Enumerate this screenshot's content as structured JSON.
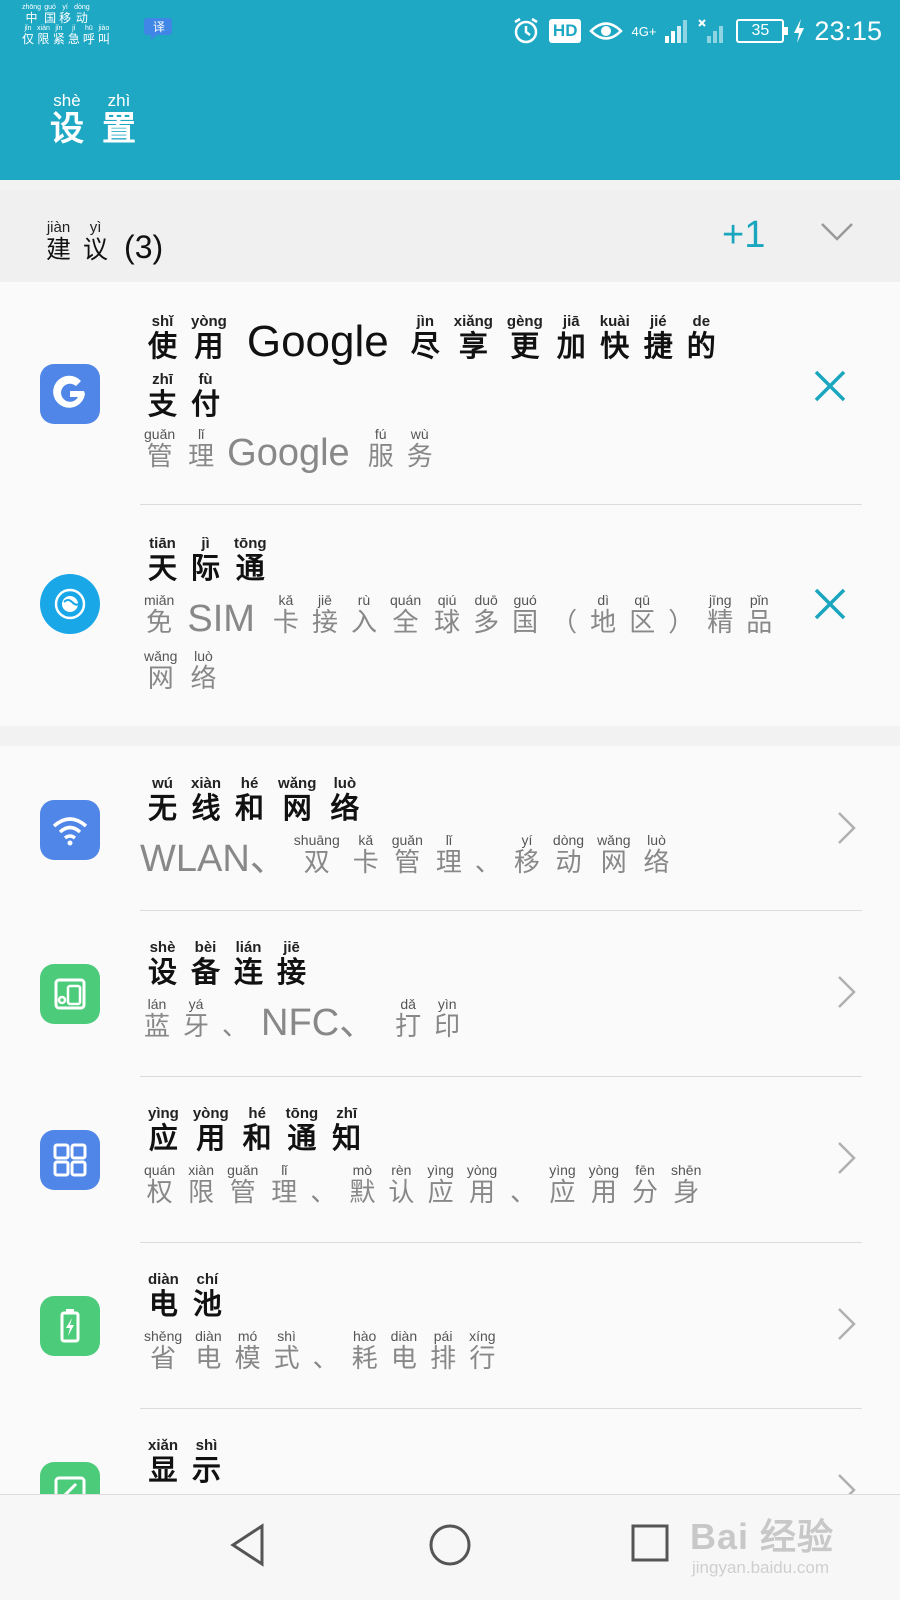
{
  "status_bar": {
    "carrier_line1": [
      {
        "char": "中",
        "py": "zhōng"
      },
      {
        "char": "国",
        "py": "guó"
      },
      {
        "char": "移",
        "py": "yí"
      },
      {
        "char": "动",
        "py": "dòng"
      }
    ],
    "carrier_line2": [
      {
        "char": "仅",
        "py": "jǐn"
      },
      {
        "char": "限",
        "py": "xiàn"
      },
      {
        "char": "紧",
        "py": "jǐn"
      },
      {
        "char": "急",
        "py": "jí"
      },
      {
        "char": "呼",
        "py": "hū"
      },
      {
        "char": "叫",
        "py": "jiào"
      }
    ],
    "translate_glyph": "译",
    "hd_label": "HD",
    "network_label": "4G+",
    "battery_level": "35",
    "time": "23:15"
  },
  "header": {
    "title": [
      {
        "char": "设",
        "py": "shè"
      },
      {
        "char": "置",
        "py": "zhì"
      }
    ]
  },
  "suggestions": {
    "title": [
      {
        "char": "建",
        "py": "jiàn"
      },
      {
        "char": "议",
        "py": "yì"
      }
    ],
    "count": "(3)",
    "more_label": "+1",
    "items": [
      {
        "title_a": [
          {
            "char": "使",
            "py": "shǐ"
          },
          {
            "char": "用",
            "py": "yòng"
          }
        ],
        "title_latin": "Google",
        "title_b": [
          {
            "char": "尽",
            "py": "jìn"
          },
          {
            "char": "享",
            "py": "xiǎng"
          },
          {
            "char": "更",
            "py": "gèng"
          },
          {
            "char": "加",
            "py": "jiā"
          },
          {
            "char": "快",
            "py": "kuài"
          },
          {
            "char": "捷",
            "py": "jié"
          },
          {
            "char": "的",
            "py": "de"
          }
        ],
        "title_c": [
          {
            "char": "支",
            "py": "zhī"
          },
          {
            "char": "付",
            "py": "fù"
          }
        ],
        "sub_a": [
          {
            "char": "管",
            "py": "guǎn"
          },
          {
            "char": "理",
            "py": "lǐ"
          }
        ],
        "sub_latin": "Google",
        "sub_b": [
          {
            "char": "服",
            "py": "fú"
          },
          {
            "char": "务",
            "py": "wù"
          }
        ],
        "icon": "google-g-icon",
        "icon_color": "#4f86e8"
      },
      {
        "title_a": [
          {
            "char": "天",
            "py": "tiān"
          },
          {
            "char": "际",
            "py": "jì"
          },
          {
            "char": "通",
            "py": "tōng"
          }
        ],
        "sub_a": [
          {
            "char": "免",
            "py": "miǎn"
          }
        ],
        "sub_latin": "SIM",
        "sub_b": [
          {
            "char": "卡",
            "py": "kǎ"
          },
          {
            "char": "接",
            "py": "jiē"
          },
          {
            "char": "入",
            "py": "rù"
          },
          {
            "char": "全",
            "py": "quán"
          },
          {
            "char": "球",
            "py": "qiú"
          },
          {
            "char": "多",
            "py": "duō"
          },
          {
            "char": "国",
            "py": "guó"
          },
          {
            "char": "（",
            "py": ""
          },
          {
            "char": "地",
            "py": "dì"
          },
          {
            "char": "区",
            "py": "qū"
          },
          {
            "char": "）",
            "py": ""
          },
          {
            "char": "精",
            "py": "jīng"
          },
          {
            "char": "品",
            "py": "pǐn"
          }
        ],
        "sub_c": [
          {
            "char": "网",
            "py": "wǎng"
          },
          {
            "char": "络",
            "py": "luò"
          }
        ],
        "icon": "globe-icon",
        "icon_color": "#1aa7e8"
      }
    ]
  },
  "settings": [
    {
      "title": [
        {
          "char": "无",
          "py": "wú"
        },
        {
          "char": "线",
          "py": "xiàn"
        },
        {
          "char": "和",
          "py": "hé"
        },
        {
          "char": "网",
          "py": "wǎng"
        },
        {
          "char": "络",
          "py": "luò"
        }
      ],
      "sub_latin": "WLAN、",
      "sub": [
        {
          "char": "双",
          "py": "shuāng"
        },
        {
          "char": "卡",
          "py": "kǎ"
        },
        {
          "char": "管",
          "py": "guǎn"
        },
        {
          "char": "理",
          "py": "lǐ"
        },
        {
          "char": "、",
          "py": ""
        },
        {
          "char": "移",
          "py": "yí"
        },
        {
          "char": "动",
          "py": "dòng"
        },
        {
          "char": "网",
          "py": "wǎng"
        },
        {
          "char": "络",
          "py": "luò"
        }
      ],
      "icon": "wifi-icon",
      "icon_color": "#4f86e8"
    },
    {
      "title": [
        {
          "char": "设",
          "py": "shè"
        },
        {
          "char": "备",
          "py": "bèi"
        },
        {
          "char": "连",
          "py": "lián"
        },
        {
          "char": "接",
          "py": "jiē"
        }
      ],
      "sub": [
        {
          "char": "蓝",
          "py": "lán"
        },
        {
          "char": "牙",
          "py": "yá"
        },
        {
          "char": "、",
          "py": ""
        }
      ],
      "sub_latin": "NFC、",
      "sub_b": [
        {
          "char": "打",
          "py": "dǎ"
        },
        {
          "char": "印",
          "py": "yìn"
        }
      ],
      "icon": "device-connection-icon",
      "icon_color": "#4ccc7a"
    },
    {
      "title": [
        {
          "char": "应",
          "py": "yìng"
        },
        {
          "char": "用",
          "py": "yòng"
        },
        {
          "char": "和",
          "py": "hé"
        },
        {
          "char": "通",
          "py": "tōng"
        },
        {
          "char": "知",
          "py": "zhī"
        }
      ],
      "sub": [
        {
          "char": "权",
          "py": "quán"
        },
        {
          "char": "限",
          "py": "xiàn"
        },
        {
          "char": "管",
          "py": "guǎn"
        },
        {
          "char": "理",
          "py": "lǐ"
        },
        {
          "char": "、",
          "py": ""
        },
        {
          "char": "默",
          "py": "mò"
        },
        {
          "char": "认",
          "py": "rèn"
        },
        {
          "char": "应",
          "py": "yìng"
        },
        {
          "char": "用",
          "py": "yòng"
        },
        {
          "char": "、",
          "py": ""
        },
        {
          "char": "应",
          "py": "yìng"
        },
        {
          "char": "用",
          "py": "yòng"
        },
        {
          "char": "分",
          "py": "fēn"
        },
        {
          "char": "身",
          "py": "shēn"
        }
      ],
      "icon": "apps-grid-icon",
      "icon_color": "#4f86e8"
    },
    {
      "title": [
        {
          "char": "电",
          "py": "diàn"
        },
        {
          "char": "池",
          "py": "chí"
        }
      ],
      "sub": [
        {
          "char": "省",
          "py": "shěng"
        },
        {
          "char": "电",
          "py": "diàn"
        },
        {
          "char": "模",
          "py": "mó"
        },
        {
          "char": "式",
          "py": "shì"
        },
        {
          "char": "、",
          "py": ""
        },
        {
          "char": "耗",
          "py": "hào"
        },
        {
          "char": "电",
          "py": "diàn"
        },
        {
          "char": "排",
          "py": "pái"
        },
        {
          "char": "行",
          "py": "xíng"
        }
      ],
      "icon": "battery-icon",
      "icon_color": "#4ccc7a"
    },
    {
      "title": [
        {
          "char": "显",
          "py": "xiǎn"
        },
        {
          "char": "示",
          "py": "shì"
        }
      ],
      "icon": "display-icon",
      "icon_color": "#4ccc7a"
    }
  ],
  "watermark": {
    "brand": "Bai 经验",
    "url": "jingyan.baidu.com"
  }
}
